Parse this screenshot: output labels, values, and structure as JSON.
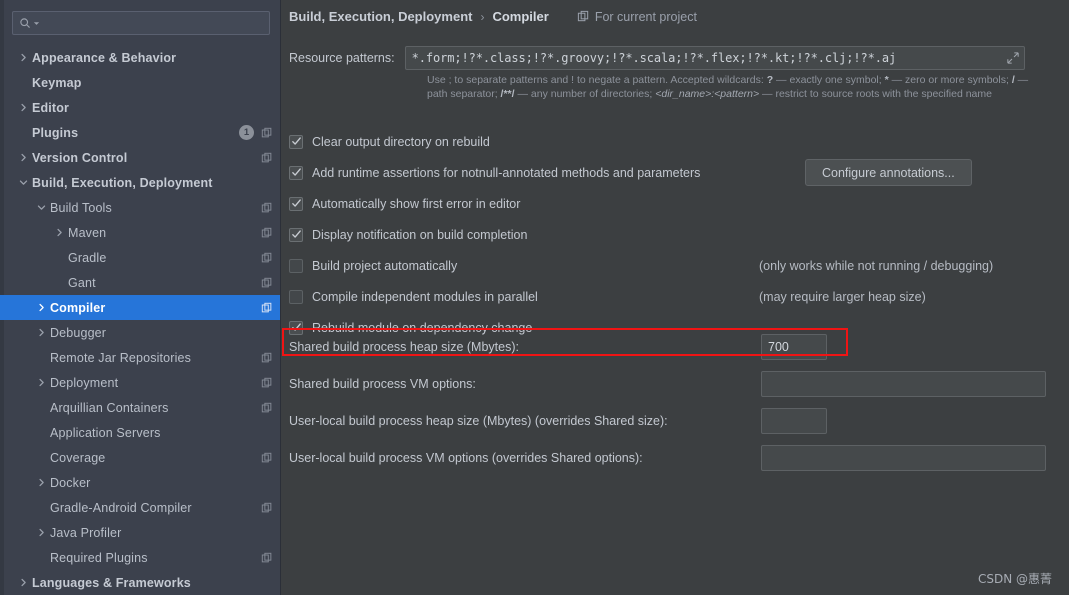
{
  "search": {
    "placeholder": "",
    "value": "",
    "icon": "search-icon",
    "dropdown_icon": "chevron-down-icon"
  },
  "sidebar": {
    "items": [
      {
        "label": "Appearance & Behavior",
        "indent": 0,
        "arrow": "collapsed",
        "bold": true,
        "badge": null,
        "copy_icon": false,
        "selected": false
      },
      {
        "label": "Keymap",
        "indent": 0,
        "arrow": "none",
        "bold": true,
        "badge": null,
        "copy_icon": false,
        "selected": false
      },
      {
        "label": "Editor",
        "indent": 0,
        "arrow": "collapsed",
        "bold": true,
        "badge": null,
        "copy_icon": false,
        "selected": false
      },
      {
        "label": "Plugins",
        "indent": 0,
        "arrow": "none",
        "bold": true,
        "badge": "1",
        "copy_icon": true,
        "selected": false
      },
      {
        "label": "Version Control",
        "indent": 0,
        "arrow": "collapsed",
        "bold": true,
        "badge": null,
        "copy_icon": true,
        "selected": false
      },
      {
        "label": "Build, Execution, Deployment",
        "indent": 0,
        "arrow": "expanded",
        "bold": true,
        "badge": null,
        "copy_icon": false,
        "selected": false
      },
      {
        "label": "Build Tools",
        "indent": 1,
        "arrow": "expanded",
        "bold": false,
        "badge": null,
        "copy_icon": true,
        "selected": false
      },
      {
        "label": "Maven",
        "indent": 2,
        "arrow": "collapsed",
        "bold": false,
        "badge": null,
        "copy_icon": true,
        "selected": false
      },
      {
        "label": "Gradle",
        "indent": 2,
        "arrow": "none",
        "bold": false,
        "badge": null,
        "copy_icon": true,
        "selected": false
      },
      {
        "label": "Gant",
        "indent": 2,
        "arrow": "none",
        "bold": false,
        "badge": null,
        "copy_icon": true,
        "selected": false
      },
      {
        "label": "Compiler",
        "indent": 1,
        "arrow": "collapsed",
        "bold": true,
        "badge": null,
        "copy_icon": true,
        "selected": true
      },
      {
        "label": "Debugger",
        "indent": 1,
        "arrow": "collapsed",
        "bold": false,
        "badge": null,
        "copy_icon": false,
        "selected": false
      },
      {
        "label": "Remote Jar Repositories",
        "indent": 1,
        "arrow": "none",
        "bold": false,
        "badge": null,
        "copy_icon": true,
        "selected": false
      },
      {
        "label": "Deployment",
        "indent": 1,
        "arrow": "collapsed",
        "bold": false,
        "badge": null,
        "copy_icon": true,
        "selected": false
      },
      {
        "label": "Arquillian Containers",
        "indent": 1,
        "arrow": "none",
        "bold": false,
        "badge": null,
        "copy_icon": true,
        "selected": false
      },
      {
        "label": "Application Servers",
        "indent": 1,
        "arrow": "none",
        "bold": false,
        "badge": null,
        "copy_icon": false,
        "selected": false
      },
      {
        "label": "Coverage",
        "indent": 1,
        "arrow": "none",
        "bold": false,
        "badge": null,
        "copy_icon": true,
        "selected": false
      },
      {
        "label": "Docker",
        "indent": 1,
        "arrow": "collapsed",
        "bold": false,
        "badge": null,
        "copy_icon": false,
        "selected": false
      },
      {
        "label": "Gradle-Android Compiler",
        "indent": 1,
        "arrow": "none",
        "bold": false,
        "badge": null,
        "copy_icon": true,
        "selected": false
      },
      {
        "label": "Java Profiler",
        "indent": 1,
        "arrow": "collapsed",
        "bold": false,
        "badge": null,
        "copy_icon": false,
        "selected": false
      },
      {
        "label": "Required Plugins",
        "indent": 1,
        "arrow": "none",
        "bold": false,
        "badge": null,
        "copy_icon": true,
        "selected": false
      },
      {
        "label": "Languages & Frameworks",
        "indent": 0,
        "arrow": "collapsed",
        "bold": true,
        "badge": null,
        "copy_icon": false,
        "selected": false
      }
    ]
  },
  "header": {
    "breadcrumb_parent": "Build, Execution, Deployment",
    "breadcrumb_separator": "›",
    "breadcrumb_current": "Compiler",
    "scope_icon": "project-scope-icon",
    "scope_label": "For current project"
  },
  "resource_patterns": {
    "label": "Resource patterns:",
    "value": "*.form;!?*.class;!?*.groovy;!?*.scala;!?*.flex;!?*.kt;!?*.clj;!?*.aj",
    "expand_icon": "expand-icon",
    "hint_prefix": "Use ; to separate patterns and ! to negate a pattern. Accepted wildcards: ",
    "hint_q": "?",
    "hint_q_desc": " — exactly one symbol; ",
    "hint_star": "*",
    "hint_star_desc": " — zero or more symbols; ",
    "hint_slash": "/",
    "hint_slash_desc": " — path separator; ",
    "hint_globstar": "/**/",
    "hint_globstar_desc": " — any number of directories; ",
    "hint_dirname": "<dir_name>:<pattern>",
    "hint_tail": " — restrict to source roots with the specified name"
  },
  "options": [
    {
      "label": "Clear output directory on rebuild",
      "checked": true,
      "note": null,
      "button": null
    },
    {
      "label": "Add runtime assertions for notnull-annotated methods and parameters",
      "checked": true,
      "note": null,
      "button": "Configure annotations..."
    },
    {
      "label": "Automatically show first error in editor",
      "checked": true,
      "note": null,
      "button": null
    },
    {
      "label": "Display notification on build completion",
      "checked": true,
      "note": null,
      "button": null
    },
    {
      "label": "Build project automatically",
      "checked": false,
      "note": "(only works while not running / debugging)",
      "button": null
    },
    {
      "label": "Compile independent modules in parallel",
      "checked": false,
      "note": "(may require larger heap size)",
      "button": null
    },
    {
      "label": "Rebuild module on dependency change",
      "checked": true,
      "note": null,
      "button": null
    }
  ],
  "fields": [
    {
      "label": "Shared build process heap size (Mbytes):",
      "value": "700",
      "placeholder": "",
      "size": "small",
      "highlighted": true
    },
    {
      "label": "Shared build process VM options:",
      "value": "",
      "placeholder": "",
      "size": "wide",
      "highlighted": false
    },
    {
      "label": "User-local build process heap size (Mbytes) (overrides Shared size):",
      "value": "",
      "placeholder": "",
      "size": "small",
      "highlighted": false
    },
    {
      "label": "User-local build process VM options (overrides Shared options):",
      "value": "",
      "placeholder": "",
      "size": "wide",
      "highlighted": false
    }
  ],
  "highlight_color": "#f01414",
  "accent_color": "#2675d9",
  "watermark": "CSDN @惠菁"
}
